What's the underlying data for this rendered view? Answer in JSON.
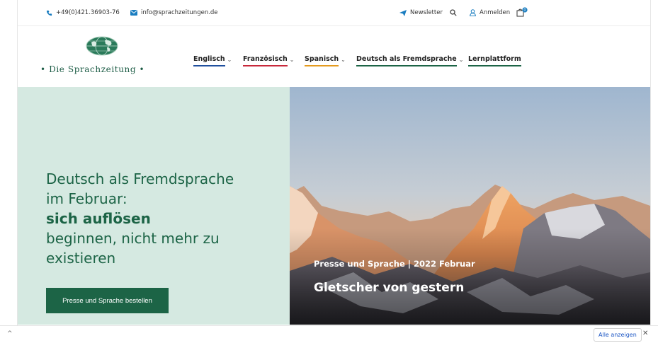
{
  "topbar": {
    "phone": "+49(0)421.36903-76",
    "email": "info@sprachzeitungen.de",
    "newsletter": "Newsletter",
    "login": "Anmelden",
    "cart_count": "0"
  },
  "brand": {
    "name": "• Die Sprachzeitung •"
  },
  "nav": {
    "items": [
      {
        "label": "Englisch",
        "chevron": "⌄",
        "accent": "#1f4f9e"
      },
      {
        "label": "Französisch",
        "chevron": "⌄",
        "accent": "#c8283a"
      },
      {
        "label": "Spanisch",
        "chevron": "⌄",
        "accent": "#e49a1e"
      },
      {
        "label": "Deutsch als Fremdsprache",
        "chevron": "⌄",
        "accent": "#1c6446"
      },
      {
        "label": "Lernplattform",
        "chevron": "",
        "accent": "#1c6446"
      }
    ]
  },
  "hero": {
    "line1": "Deutsch als Fremdsprache",
    "line2": "im Februar:",
    "bold": "sich auflösen",
    "line3": "beginnen, nicht mehr zu",
    "line4": "existieren",
    "cta": "Presse und Sprache bestellen",
    "kicker": "Presse und Sprache | 2022 Februar",
    "title": "Gletscher von gestern"
  },
  "bottombar": {
    "chevron": "^",
    "show_all": "Alle anzeigen",
    "close": "✕"
  },
  "colors": {
    "brand_green": "#1c6446",
    "hero_bg": "#d5e9e1"
  }
}
